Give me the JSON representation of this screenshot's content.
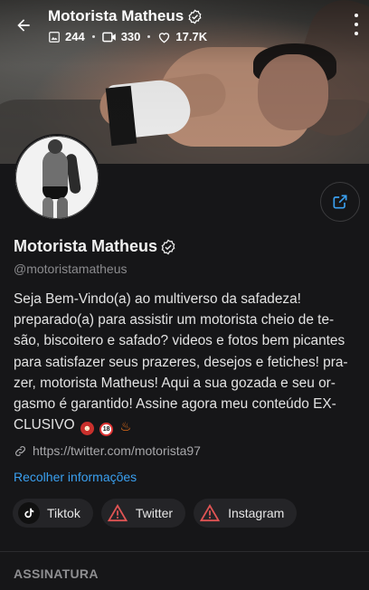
{
  "profile": {
    "name": "Motorista Matheus",
    "handle": "@motoristamatheus",
    "stats": {
      "photos": "244",
      "videos": "330",
      "likes": "17.7K"
    },
    "bio_lines": [
      "Seja Bem-Vindo(a) ao multiverso da safadeza!",
      "preparado(a) para assistir um motorista cheio de te-",
      "são, biscoitero e safado? videos e fotos bem picantes",
      "para satisfazer seus prazeres, desejos e fetiches! pra-",
      "zer, motorista Matheus! Aqui a sua gozada e seu or-",
      "gasmo é garantido! Assine agora meu conteúdo EX-",
      "CLUSIVO"
    ],
    "bio_emojis": [
      "devil-emoji",
      "no-under-18-emoji",
      "fire-emoji"
    ],
    "website": "https://twitter.com/motorista97",
    "collapse_label": "Recolher informações"
  },
  "socials": [
    {
      "label": "Tiktok",
      "icon": "tiktok-icon"
    },
    {
      "label": "Twitter",
      "icon": "warning-icon"
    },
    {
      "label": "Instagram",
      "icon": "warning-icon"
    }
  ],
  "section": {
    "title": "ASSINATURA"
  },
  "colors": {
    "background": "#161618",
    "link": "#3aa0f0",
    "accent_share": "#3aa0f0",
    "chip_bg": "#242427",
    "warning": "#e05454"
  }
}
